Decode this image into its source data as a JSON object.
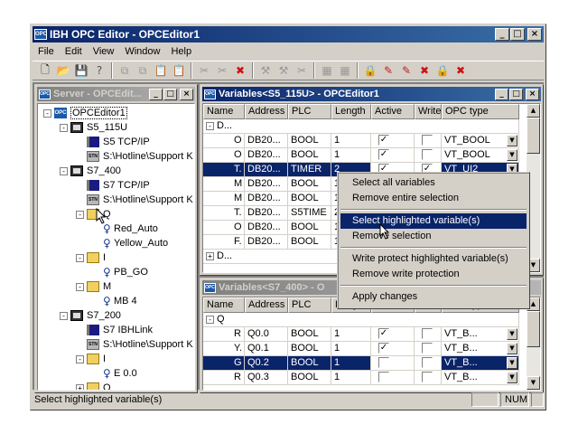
{
  "app": {
    "title": "IBH OPC Editor - OPCEditor1",
    "icon_text": "OPC"
  },
  "menu": [
    "File",
    "Edit",
    "View",
    "Window",
    "Help"
  ],
  "toolbar_icons": [
    "new-icon",
    "open-icon",
    "save-icon",
    "help-icon",
    "sep",
    "copy-icon",
    "copy-icon",
    "paste-icon",
    "paste-icon",
    "sep",
    "cut-icon",
    "cut-icon",
    "delete-icon",
    "sep",
    "tool-icon",
    "tool-icon",
    "scissors-icon",
    "sep",
    "grid-icon",
    "grid-icon",
    "sep",
    "lock-icon",
    "write-icon",
    "write-icon",
    "delete-icon",
    "lock-icon",
    "delete-icon"
  ],
  "server_window": {
    "title": "Server - OPCEdit...",
    "tree": [
      {
        "label": "OPCEditor1",
        "icon": "opc",
        "depth": 0,
        "exp": "-",
        "selected": true
      },
      {
        "label": "S5_115U",
        "icon": "plc",
        "depth": 1,
        "exp": "-"
      },
      {
        "label": "S5 TCP/IP",
        "icon": "net",
        "depth": 2,
        "exp": ""
      },
      {
        "label": "S:\\Hotline\\Support K",
        "icon": "stn",
        "depth": 2,
        "exp": ""
      },
      {
        "label": "S7_400",
        "icon": "plc",
        "depth": 1,
        "exp": "-"
      },
      {
        "label": "S7 TCP/IP",
        "icon": "net",
        "depth": 2,
        "exp": ""
      },
      {
        "label": "S:\\Hotline\\Support K",
        "icon": "stn",
        "depth": 2,
        "exp": ""
      },
      {
        "label": "Q",
        "icon": "folder",
        "depth": 2,
        "exp": "-"
      },
      {
        "label": "Red_Auto",
        "icon": "var",
        "depth": 3,
        "exp": ""
      },
      {
        "label": "Yellow_Auto",
        "icon": "var",
        "depth": 3,
        "exp": ""
      },
      {
        "label": "I",
        "icon": "folder",
        "depth": 2,
        "exp": "-"
      },
      {
        "label": "PB_GO",
        "icon": "var",
        "depth": 3,
        "exp": ""
      },
      {
        "label": "M",
        "icon": "folder",
        "depth": 2,
        "exp": "-"
      },
      {
        "label": "MB 4",
        "icon": "var",
        "depth": 3,
        "exp": ""
      },
      {
        "label": "S7_200",
        "icon": "plc",
        "depth": 1,
        "exp": "-"
      },
      {
        "label": "S7 IBHLink",
        "icon": "net",
        "depth": 2,
        "exp": ""
      },
      {
        "label": "S:\\Hotline\\Support K",
        "icon": "stn",
        "depth": 2,
        "exp": ""
      },
      {
        "label": "I",
        "icon": "folder",
        "depth": 2,
        "exp": "-"
      },
      {
        "label": "E 0.0",
        "icon": "var",
        "depth": 3,
        "exp": ""
      },
      {
        "label": "O",
        "icon": "folder",
        "depth": 2,
        "exp": "+"
      }
    ]
  },
  "vars1": {
    "title": "Variables<S5_115U> - OPCEditor1",
    "columns": [
      "Name",
      "Address",
      "PLC",
      "Length",
      "Active",
      "Write",
      "OPC type"
    ],
    "group_label": "D...",
    "group_label_bottom": "D...",
    "rows": [
      {
        "name": "O",
        "address": "DB20...",
        "plc": "BOOL",
        "length": "1",
        "active": true,
        "write": false,
        "type": "VT_BOOL",
        "selected": false
      },
      {
        "name": "O",
        "address": "DB20...",
        "plc": "BOOL",
        "length": "1",
        "active": true,
        "write": false,
        "type": "VT_BOOL",
        "selected": false
      },
      {
        "name": "T.",
        "address": "DB20...",
        "plc": "TIMER",
        "length": "2",
        "active": true,
        "write": true,
        "type": "VT_UI2",
        "selected": true
      },
      {
        "name": "M",
        "address": "DB20...",
        "plc": "BOOL",
        "length": "1",
        "active": false,
        "write": false,
        "type": "",
        "selected": false
      },
      {
        "name": "M",
        "address": "DB20...",
        "plc": "BOOL",
        "length": "1",
        "active": false,
        "write": false,
        "type": "",
        "selected": false
      },
      {
        "name": "T.",
        "address": "DB20...",
        "plc": "S5TIME",
        "length": "2",
        "active": false,
        "write": false,
        "type": "",
        "selected": false
      },
      {
        "name": "O",
        "address": "DB20...",
        "plc": "BOOL",
        "length": "1",
        "active": false,
        "write": false,
        "type": "",
        "selected": false
      },
      {
        "name": "F.",
        "address": "DB20...",
        "plc": "BOOL",
        "length": "1",
        "active": false,
        "write": false,
        "type": "",
        "selected": false
      }
    ]
  },
  "vars2": {
    "title": "Variables<S7_400> - O",
    "columns": [
      "Name",
      "Address",
      "PLC",
      "Length",
      "Active",
      "Write",
      "OPC type"
    ],
    "group_label": "Q",
    "rows": [
      {
        "name": "R",
        "address": "Q0.0",
        "plc": "BOOL",
        "length": "1",
        "active": true,
        "write": false,
        "type": "VT_B...",
        "selected": false
      },
      {
        "name": "Y.",
        "address": "Q0.1",
        "plc": "BOOL",
        "length": "1",
        "active": true,
        "write": false,
        "type": "VT_B...",
        "selected": false
      },
      {
        "name": "G",
        "address": "Q0.2",
        "plc": "BOOL",
        "length": "1",
        "active": false,
        "write": false,
        "type": "VT_B...",
        "selected": true
      },
      {
        "name": "R",
        "address": "Q0.3",
        "plc": "BOOL",
        "length": "1",
        "active": false,
        "write": false,
        "type": "VT_B...",
        "selected": false
      }
    ]
  },
  "context_menu": {
    "items": [
      {
        "label": "Select all variables",
        "highlighted": false
      },
      {
        "label": "Remove entire selection",
        "highlighted": false
      },
      {
        "sep": true
      },
      {
        "label": "Select highlighted variable(s)",
        "highlighted": true
      },
      {
        "label": "Remove selection",
        "highlighted": false
      },
      {
        "sep": true
      },
      {
        "label": "Write protect highlighted variable(s)",
        "highlighted": false
      },
      {
        "label": "Remove write protection",
        "highlighted": false
      },
      {
        "sep": true
      },
      {
        "label": "Apply changes",
        "highlighted": false
      }
    ]
  },
  "status": {
    "text": "Select highlighted variable(s)",
    "num": "NUM"
  },
  "colors": {
    "title_active": "#0a246a",
    "face": "#d4d0c8",
    "selection": "#0a246a"
  }
}
